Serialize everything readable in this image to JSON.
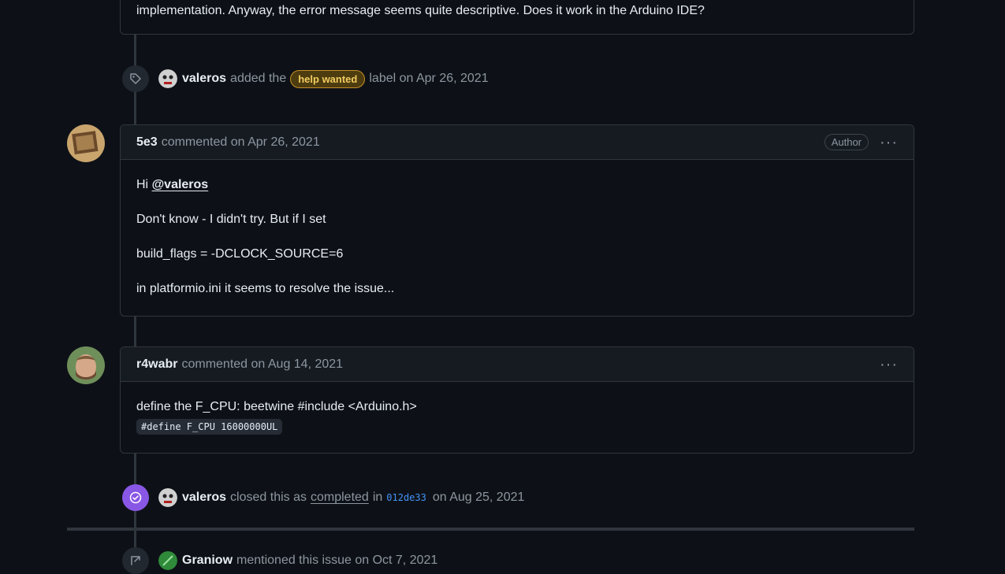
{
  "top_comment": {
    "text": "implementation. Anyway, the error message seems quite descriptive. Does it work in the Arduino IDE?"
  },
  "label_event": {
    "actor": "valeros",
    "action": "added the",
    "label": "help wanted",
    "suffix": "label on Apr 26, 2021",
    "icon": "tag-icon"
  },
  "comment1": {
    "author": "5e3",
    "meta": "commented on Apr 26, 2021",
    "badge": "Author",
    "more": "···",
    "greeting": "Hi",
    "mention": "@valeros",
    "line1": "Don't know - I didn't try. But if I set",
    "line2": "build_flags = -DCLOCK_SOURCE=6",
    "line3": "in platformio.ini it seems to resolve the issue..."
  },
  "comment2": {
    "author": "r4wabr",
    "meta": "commented on Aug 14, 2021",
    "more": "···",
    "line1": "define the F_CPU: beetwine #include <Arduino.h>",
    "code": "#define F_CPU 16000000UL"
  },
  "close_event": {
    "actor": "valeros",
    "action": "closed this as",
    "state": "completed",
    "in": "in",
    "commit": "012de33",
    "date": "on Aug 25, 2021",
    "icon": "check-circle-icon",
    "badge_color": "#8957e5"
  },
  "mention_event": {
    "actor": "Graniow",
    "text": "mentioned this issue on Oct 7, 2021",
    "icon": "cross-reference-icon"
  },
  "colors": {
    "background": "#0d1117",
    "label_text": "#f2cc60",
    "link": "#4493f8"
  }
}
